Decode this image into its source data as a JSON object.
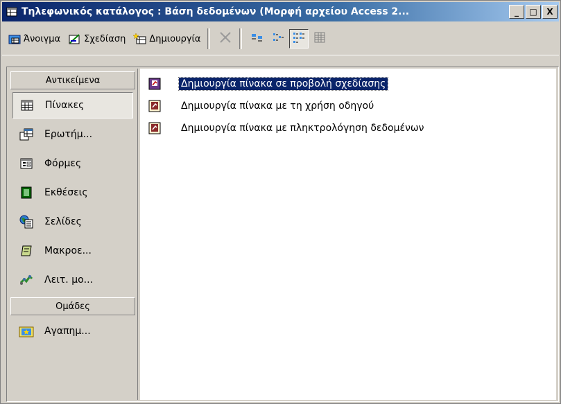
{
  "window": {
    "title": "Τηλεφωνικός κατάλογος : Βάση δεδομένων (Μορφή αρχείου Access 2...",
    "buttons": {
      "minimize": "_",
      "maximize": "□",
      "close": "X"
    }
  },
  "toolbar": {
    "open_label": "Άνοιγμα",
    "design_label": "Σχεδίαση",
    "new_label": "Δημιουργία"
  },
  "sidebar": {
    "objects_header": "Αντικείμενα",
    "items": [
      {
        "label": "Πίνακες",
        "icon": "table-icon"
      },
      {
        "label": "Ερωτήμ...",
        "icon": "query-icon"
      },
      {
        "label": "Φόρμες",
        "icon": "form-icon"
      },
      {
        "label": "Εκθέσεις",
        "icon": "report-icon"
      },
      {
        "label": "Σελίδες",
        "icon": "page-icon"
      },
      {
        "label": "Μακροε...",
        "icon": "macro-icon"
      },
      {
        "label": "Λειτ. μο...",
        "icon": "module-icon"
      }
    ],
    "groups_header": "Ομάδες",
    "group_items": [
      {
        "label": "Αγαπημ...",
        "icon": "favorites-icon"
      }
    ]
  },
  "content": {
    "items": [
      {
        "label": "Δημιουργία πίνακα σε προβολή σχεδίασης"
      },
      {
        "label": "Δημιουργία πίνακα με τη χρήση οδηγού"
      },
      {
        "label": "Δημιουργία πίνακα με πληκτρολόγηση δεδομένων"
      }
    ]
  },
  "colors": {
    "title_start": "#0a246a",
    "title_end": "#a6caf0",
    "selection": "#0a246a",
    "face": "#d4d0c8"
  }
}
